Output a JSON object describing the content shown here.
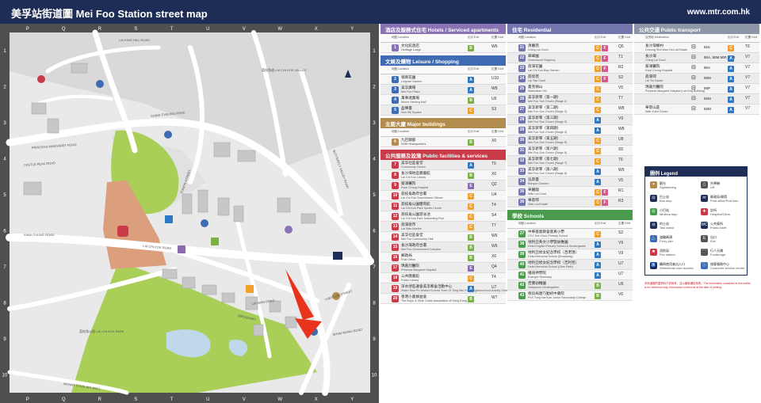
{
  "header": {
    "title": "美孚站街道圖 Mei Foo Station street map",
    "website": "www.mtr.com.hk"
  },
  "map": {
    "columns": [
      "P",
      "Q",
      "R",
      "S",
      "T",
      "U",
      "V",
      "W",
      "X",
      "Y"
    ],
    "rows": [
      "1",
      "2",
      "3",
      "4",
      "5",
      "6",
      "7",
      "8",
      "9",
      "10"
    ],
    "labels": {
      "lai_king_hill": "LAI KING HILL ROAD",
      "lai_chi_kok_valley": "荔枝角道 LAI CHI KOK VALLEY",
      "ching_cheung": "CHING CHEUNG ROAD",
      "castle_peak": "CASTLE PEAK ROAD",
      "lai_chi_kok_road": "LAI CHI KOK ROAD",
      "kwai_chung": "KWAI CHUNG ROAD",
      "mei_foo_park": "荔枝角公園 LAI CHI KOK PARK",
      "tonkin": "TONKIN STREET",
      "butterfly": "BUTTERFLY VALLEY ROAD",
      "broadway": "BROADWAY",
      "yuet_lun": "YUET LUN STREET",
      "sham_mong": "SHAM MONG ROAD",
      "princess_margaret": "PRINCESS MARGARET ROAD",
      "lai_wan": "LAI WAN ROAD",
      "mount_sterling": "MOUNT STERLING MALL"
    }
  },
  "hotels": {
    "title": "酒店及服務式住宅 Hotels / Serviced apartments",
    "col_name": "地點 Location",
    "col_exit": "出口 Exit",
    "col_grid": "位置 Grid",
    "rows": [
      {
        "n": "1",
        "zh": "文化館酒店",
        "en": "Heritage Lodge",
        "exit": "B",
        "grid": "W6"
      }
    ]
  },
  "leisure": {
    "title": "文娛及購物 Leisure / Shopping",
    "rows": [
      {
        "n": "2",
        "zh": "嶺南花園",
        "en": "Lingnan Garden",
        "exit": "A",
        "grid": "U10"
      },
      {
        "n": "3",
        "zh": "美孚廣場",
        "en": "Mei Foo Plaza",
        "exit": "A",
        "grid": "W8"
      },
      {
        "n": "4",
        "zh": "萬事達廣場",
        "en": "Mount Sterling Mall",
        "exit": "B",
        "grid": "U6"
      },
      {
        "n": "5",
        "zh": "盈暉臺",
        "en": "Noh Hill Square",
        "exit": "C",
        "grid": "S3"
      }
    ]
  },
  "major": {
    "title": "主要大廈 Major buildings",
    "rows": [
      {
        "n": "6",
        "zh": "九巴總部",
        "en": "KMB Headquarters",
        "exit": "B",
        "grid": "X6"
      }
    ]
  },
  "public_fac": {
    "title": "公共服務及設施 Public facilities & services",
    "rows": [
      {
        "n": "7",
        "zh": "美孚社區會堂",
        "en": "Community Centre",
        "exit": "A",
        "grid": "T9"
      },
      {
        "n": "8",
        "zh": "長沙灣地區圖書館",
        "en": "Lai Chi Kok Library",
        "exit": "B",
        "grid": "X6"
      },
      {
        "n": "9",
        "zh": "葵涌醫院",
        "en": "Kwai Chung Hospital",
        "exit": "E",
        "grid": "Q2"
      },
      {
        "n": "10",
        "zh": "荔枝角政府合署",
        "en": "Lai Chi Kok Government Offices",
        "exit": "C",
        "grid": "U4"
      },
      {
        "n": "11",
        "zh": "荔枝角公園體育館",
        "en": "Lai Chi Kok Park Sports Centre",
        "exit": "C",
        "grid": "T4"
      },
      {
        "n": "12",
        "zh": "荔枝角公園游泳池",
        "en": "Lai Chi Kok Park Swimming Pool",
        "exit": "C",
        "grid": "S4"
      },
      {
        "n": "13",
        "zh": "荔灣街市",
        "en": "Lai Wan Market",
        "exit": "C",
        "grid": "T7"
      },
      {
        "n": "14",
        "zh": "美孚社區會堂",
        "en": "Mei Foo Community Hall",
        "exit": "B",
        "grid": "W6"
      },
      {
        "n": "15",
        "zh": "長沙灣政府合署",
        "en": "Mei Foo Government Complex",
        "exit": "B",
        "grid": "W6"
      },
      {
        "n": "16",
        "zh": "郵政局",
        "en": "Post Office",
        "exit": "B",
        "grid": "X6"
      },
      {
        "n": "17",
        "zh": "瑪嘉烈醫院",
        "en": "Princess Margaret Hospital",
        "exit": "E",
        "grid": "Q4"
      },
      {
        "n": "18",
        "zh": "公共圖書館",
        "en": "Public Library",
        "exit": "C",
        "grid": "T4"
      },
      {
        "n": "19",
        "zh": "深水埗區議會美孚鄰舍活動中心",
        "en": "Sham Shui Po District Council Yuen Oi Tong Mei Foo Neighbourhood Activity Centre",
        "exit": "A",
        "grid": "U7"
      },
      {
        "n": "20",
        "zh": "香港小童群益會",
        "en": "The Boys' & Girls' Clubs Association of Hong Kong",
        "exit": "B",
        "grid": "W7"
      }
    ]
  },
  "residential": {
    "title": "住宅 Residential",
    "rows": [
      {
        "n": "21",
        "zh": "清麗苑",
        "en": "Ching Lai Court",
        "exits": "C F",
        "grid": "Q5"
      },
      {
        "n": "22",
        "zh": "翠峰園",
        "en": "Greenwood Regency",
        "exits": "C F",
        "grid": "T1"
      },
      {
        "n": "23",
        "zh": "荔灣花園",
        "en": "Lai Chi Kok Bay Garden",
        "exits": "C F",
        "grid": "R2"
      },
      {
        "n": "24",
        "zh": "荔欣苑",
        "en": "Lai Yan Court",
        "exits": "C F",
        "grid": "S2"
      },
      {
        "n": "25",
        "zh": "曼克頓山",
        "en": "Manhattan Hill",
        "exits": "C",
        "grid": "V5"
      },
      {
        "n": "26",
        "zh": "美孚新邨（第一期）",
        "en": "Mei Foo Sun Chuen (Stage 1)",
        "exits": "C",
        "grid": "T7"
      },
      {
        "n": "27",
        "zh": "美孚新邨（第二期）",
        "en": "Mei Foo Sun Chuen (Stage 2)",
        "exits": "C",
        "grid": "W8"
      },
      {
        "n": "28",
        "zh": "美孚新邨（第三期）",
        "en": "Mei Foo Sun Chuen (Stage 3)",
        "exits": "A",
        "grid": "V9"
      },
      {
        "n": "29",
        "zh": "美孚新邨（第四期）",
        "en": "Mei Foo Sun Chuen (Stage 4)",
        "exits": "A",
        "grid": "W8"
      },
      {
        "n": "30",
        "zh": "美孚新邨（第五期）",
        "en": "Mei Foo Sun Chuen (Stage 5)",
        "exits": "C",
        "grid": "U8"
      },
      {
        "n": "31",
        "zh": "美孚新邨（第六期）",
        "en": "Mei Foo Sun Chuen (Stage 6)",
        "exits": "C",
        "grid": "S5"
      },
      {
        "n": "32",
        "zh": "美孚新邨（第七期）",
        "en": "Mei Foo Sun Chuen (Stage 7)",
        "exits": "C",
        "grid": "T6"
      },
      {
        "n": "33",
        "zh": "美孚新邨（第八期）",
        "en": "Mei Foo Sun Chuen (Stage 8)",
        "exits": "A",
        "grid": "W9"
      },
      {
        "n": "34",
        "zh": "泓景臺",
        "en": "Banyan Garden",
        "exits": "A",
        "grid": "V5"
      },
      {
        "n": "35",
        "zh": "華麗閣",
        "en": "Wah Lai Court",
        "exits": "C F",
        "grid": "R1"
      },
      {
        "n": "36",
        "zh": "華荔邨",
        "en": "Wah Lai Estate",
        "exits": "C F",
        "grid": "R3"
      }
    ]
  },
  "schools": {
    "title": "學校 Schools",
    "rows": [
      {
        "n": "37",
        "zh": "中華基督教會基真小學",
        "en": "CCC Kei Chun Primary School",
        "exits": "C",
        "grid": "S2"
      },
      {
        "n": "38",
        "zh": "地利亞英文小學暨幼稚園",
        "en": "Delia English Primary School & Kindergarten",
        "exits": "A",
        "grid": "V9"
      },
      {
        "n": "39",
        "zh": "地利亞修女紀念學校（百老匯）",
        "en": "Delia Memorial School (Broadway)",
        "exits": "A",
        "grid": "V9"
      },
      {
        "n": "40",
        "zh": "地利亞修女紀念學校（吉利徑）",
        "en": "Delia Memorial School (Glee Path)",
        "exits": "A",
        "grid": "U7"
      },
      {
        "n": "41",
        "zh": "播道神學院",
        "en": "Evangel Seminary",
        "exits": "A",
        "grid": "U7"
      },
      {
        "n": "42",
        "zh": "佳寶幼稚園",
        "en": "Gaiaprono Kindergarten",
        "exits": "B",
        "grid": "U6"
      },
      {
        "n": "43",
        "zh": "保良局唐乃勤初中書院",
        "en": "PLK Tong Nai Kan Junior Secondary College",
        "exits": "B",
        "grid": "V6"
      }
    ]
  },
  "transport": {
    "title": "公共交通 Public transport",
    "col_dest": "目的地 Destination",
    "rows": [
      {
        "zh": "長沙灣鄉村",
        "en": "Cheung Sha Wan Hoi Lai Estate",
        "route": "81K",
        "exit": "C",
        "grid": "T6"
      },
      {
        "zh": "長沙灣",
        "en": "Ching Lai Court",
        "route": "90A, 90M 90P, 92M",
        "exit": "A",
        "grid": "V7"
      },
      {
        "zh": "葵涌醫院",
        "en": "Kwai Chung Hospital",
        "route": "90A",
        "exit": "A",
        "grid": "V7"
      },
      {
        "zh": "荔灣邨",
        "en": "Lai Yiu Estate",
        "route": "90M",
        "exit": "A",
        "grid": "V7"
      },
      {
        "zh": "瑪嘉烈醫院",
        "en": "Princess Margaret Hospital (Lai King Building)",
        "route": "90P",
        "exit": "A",
        "grid": "V7"
      },
      {
        "zh": "",
        "en": "",
        "route": "92M",
        "exit": "A",
        "grid": "V7"
      },
      {
        "zh": "華景山莊",
        "en": "Wah Yuen Chuen",
        "route": "92M",
        "exit": "A",
        "grid": "V7"
      }
    ]
  },
  "legend": {
    "title": "圖例 Legend",
    "items": [
      [
        "觀光",
        "Sightseeing"
      ],
      [
        "升降機",
        "Lift"
      ],
      [
        "巴士站",
        "Bus stop"
      ],
      [
        "郵政局/郵筒",
        "Post office/Post box"
      ],
      [
        "小巴站",
        "Minibus stop"
      ],
      [
        "診所",
        "Hospital/Clinic"
      ],
      [
        "的士站",
        "Taxi stand"
      ],
      [
        "公共廁所",
        "Public toilet"
      ],
      [
        "渡輪碼頭",
        "Ferry pier"
      ],
      [
        "出口",
        "Exit"
      ],
      [
        "消防局",
        "Fire station"
      ],
      [
        "行人天橋",
        "Footbridge"
      ],
      [
        "輪椅使用者出入口",
        "Wheelchair user access"
      ],
      [
        "旅客服務中心",
        "Customer service centre"
      ]
    ]
  },
  "footnote": "本街道圖所載資料只供參考，並以最新通告為準。The information contained in this leaflet is for reference only. Information correct as at the date of printing.",
  "colors": {
    "navy": "#1e2d55",
    "purple": "#8a72b5",
    "blue": "#3f6bb2",
    "gold": "#b28c4e",
    "red": "#c93b48",
    "periwinkle": "#7276ad",
    "green": "#4b9b4f",
    "gray": "#8d96a6",
    "exitA": "#2e78c4",
    "exitB": "#7ab142",
    "exitC": "#f0a02b",
    "exitE": "#8b6ab1",
    "exitF": "#d35a8a"
  }
}
